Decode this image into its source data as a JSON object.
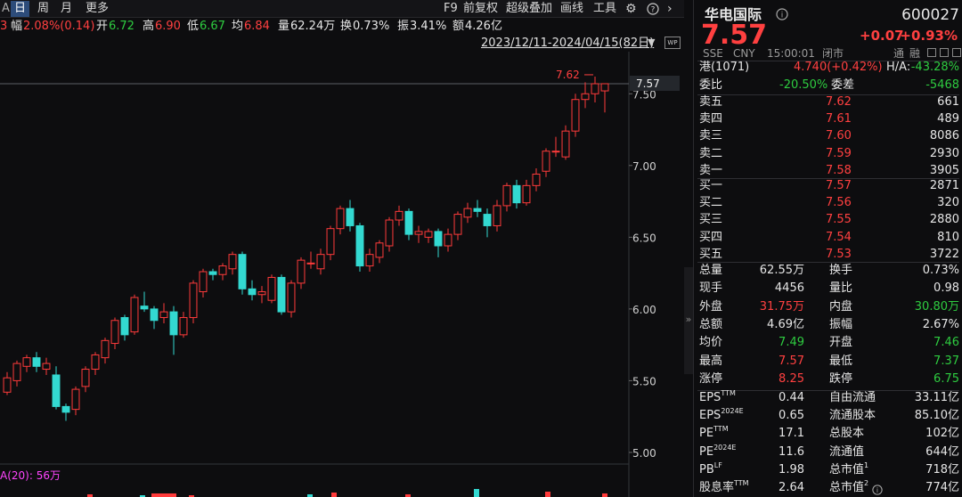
{
  "toolbar": {
    "left_glyph": "A",
    "periods": [
      "日",
      "周",
      "月",
      "更多"
    ],
    "active_period": "日",
    "tools": [
      "F9",
      "前复权",
      "超级叠加",
      "画线",
      "工具"
    ],
    "icons": [
      "gear-icon",
      "help-icon",
      "chevron-left-icon",
      "chevron-right-icon"
    ]
  },
  "info": {
    "lead": "3",
    "change_label": "幅",
    "change_value": "2.08%(0.14)",
    "open_label": "开",
    "open_value": "6.72",
    "high_label": "高",
    "high_value": "6.90",
    "low_label": "低",
    "low_value": "6.67",
    "avg_label": "均",
    "avg_value": "6.84",
    "vol_label": "量",
    "vol_value": "62.24万",
    "turnover_label": "换",
    "turnover_value": "0.73%",
    "amp_label": "振",
    "amp_value": "3.41%",
    "amount_label": "额",
    "amount_value": "4.26亿"
  },
  "range_label": "2023/12/11-2024/04/15(82日)",
  "range_arrow": "▼",
  "wp_label": "WP",
  "chart_data": {
    "type": "candlestick",
    "ylim": [
      4.95,
      7.57
    ],
    "y_ticks": [
      "7.50",
      "7.00",
      "6.50",
      "6.00",
      "5.50",
      "5.00"
    ],
    "y_tick_values": [
      7.5,
      7.0,
      6.5,
      6.0,
      5.5,
      5.0
    ],
    "last_price_label": "7.57",
    "high_annotation": "7.62",
    "volume_label": "A(20): 56万",
    "candles": [
      [
        5.42,
        5.52,
        5.4,
        5.56
      ],
      [
        5.5,
        5.62,
        5.46,
        5.64
      ],
      [
        5.6,
        5.66,
        5.56,
        5.68
      ],
      [
        5.66,
        5.6,
        5.56,
        5.7
      ],
      [
        5.58,
        5.62,
        5.54,
        5.66
      ],
      [
        5.54,
        5.32,
        5.3,
        5.6
      ],
      [
        5.32,
        5.28,
        5.22,
        5.34
      ],
      [
        5.3,
        5.44,
        5.26,
        5.46
      ],
      [
        5.46,
        5.58,
        5.42,
        5.6
      ],
      [
        5.58,
        5.68,
        5.54,
        5.7
      ],
      [
        5.66,
        5.78,
        5.62,
        5.8
      ],
      [
        5.76,
        5.92,
        5.72,
        5.94
      ],
      [
        5.94,
        5.82,
        5.78,
        5.96
      ],
      [
        5.84,
        6.08,
        5.82,
        6.1
      ],
      [
        6.02,
        6.0,
        5.98,
        6.12
      ],
      [
        6.0,
        5.92,
        5.86,
        6.02
      ],
      [
        5.94,
        5.98,
        5.9,
        6.04
      ],
      [
        5.98,
        5.82,
        5.68,
        6.02
      ],
      [
        5.82,
        5.94,
        5.8,
        5.98
      ],
      [
        5.94,
        6.18,
        5.9,
        6.2
      ],
      [
        6.12,
        6.26,
        6.08,
        6.28
      ],
      [
        6.26,
        6.24,
        6.2,
        6.28
      ],
      [
        6.24,
        6.3,
        6.2,
        6.32
      ],
      [
        6.28,
        6.38,
        6.24,
        6.4
      ],
      [
        6.38,
        6.14,
        6.1,
        6.4
      ],
      [
        6.14,
        6.1,
        6.06,
        6.2
      ],
      [
        6.1,
        6.12,
        6.04,
        6.16
      ],
      [
        6.06,
        6.22,
        6.04,
        6.24
      ],
      [
        6.22,
        5.98,
        5.96,
        6.24
      ],
      [
        5.98,
        6.18,
        5.94,
        6.2
      ],
      [
        6.18,
        6.34,
        6.14,
        6.36
      ],
      [
        6.32,
        6.32,
        6.28,
        6.4
      ],
      [
        6.28,
        6.38,
        6.24,
        6.42
      ],
      [
        6.38,
        6.56,
        6.34,
        6.58
      ],
      [
        6.56,
        6.7,
        6.52,
        6.72
      ],
      [
        6.7,
        6.58,
        6.54,
        6.76
      ],
      [
        6.58,
        6.3,
        6.26,
        6.6
      ],
      [
        6.3,
        6.38,
        6.26,
        6.42
      ],
      [
        6.36,
        6.46,
        6.32,
        6.48
      ],
      [
        6.44,
        6.62,
        6.4,
        6.64
      ],
      [
        6.62,
        6.68,
        6.58,
        6.72
      ],
      [
        6.68,
        6.52,
        6.48,
        6.7
      ],
      [
        6.52,
        6.54,
        6.46,
        6.58
      ],
      [
        6.5,
        6.54,
        6.46,
        6.56
      ],
      [
        6.54,
        6.44,
        6.36,
        6.56
      ],
      [
        6.44,
        6.52,
        6.4,
        6.56
      ],
      [
        6.52,
        6.66,
        6.48,
        6.68
      ],
      [
        6.64,
        6.7,
        6.6,
        6.74
      ],
      [
        6.7,
        6.68,
        6.64,
        6.76
      ],
      [
        6.66,
        6.58,
        6.5,
        6.7
      ],
      [
        6.58,
        6.72,
        6.54,
        6.76
      ],
      [
        6.72,
        6.86,
        6.68,
        6.88
      ],
      [
        6.86,
        6.74,
        6.7,
        6.9
      ],
      [
        6.74,
        6.86,
        6.72,
        6.9
      ],
      [
        6.86,
        6.94,
        6.82,
        6.98
      ],
      [
        6.96,
        7.1,
        6.92,
        7.12
      ],
      [
        7.1,
        7.1,
        7.06,
        7.2
      ],
      [
        7.06,
        7.24,
        7.04,
        7.28
      ],
      [
        7.24,
        7.46,
        7.2,
        7.5
      ],
      [
        7.46,
        7.5,
        7.4,
        7.58
      ],
      [
        7.5,
        7.57,
        7.44,
        7.62
      ],
      [
        7.52,
        7.57,
        7.37,
        7.57
      ]
    ],
    "volumes": [
      0.3,
      0.2,
      0.4,
      0.2,
      0.3,
      0.5,
      0.3,
      0.9,
      0.6,
      0.4
    ]
  },
  "stock": {
    "name": "华电国际",
    "info_icon": "info-icon",
    "code": "600027",
    "price": "7.57",
    "change": "+0.07",
    "change_pct": "+0.93%",
    "exchange": "SSE",
    "currency": "CNY",
    "time": "15:00:01",
    "status": "闭市",
    "tags": [
      "通",
      "融"
    ],
    "hk_label": "港(1071)",
    "hk_value": "4.740(+0.42%)",
    "ha_label": "H/A:",
    "ha_value": "-43.28%"
  },
  "order_stats": {
    "wb_label": "委比",
    "wb_value": "-20.50%",
    "wc_label": "委差",
    "wc_value": "-5468"
  },
  "asks": [
    {
      "label": "卖五",
      "price": "7.62",
      "volume": "661"
    },
    {
      "label": "卖四",
      "price": "7.61",
      "volume": "489"
    },
    {
      "label": "卖三",
      "price": "7.60",
      "volume": "8086"
    },
    {
      "label": "卖二",
      "price": "7.59",
      "volume": "2930"
    },
    {
      "label": "卖一",
      "price": "7.58",
      "volume": "3905"
    }
  ],
  "bids": [
    {
      "label": "买一",
      "price": "7.57",
      "volume": "2871"
    },
    {
      "label": "买二",
      "price": "7.56",
      "volume": "320"
    },
    {
      "label": "买三",
      "price": "7.55",
      "volume": "2880"
    },
    {
      "label": "买四",
      "price": "7.54",
      "volume": "810"
    },
    {
      "label": "买五",
      "price": "7.53",
      "volume": "3722"
    }
  ],
  "stats": [
    {
      "l1": "总量",
      "v1": "62.55万",
      "c1": "white",
      "l2": "换手",
      "v2": "0.73%",
      "c2": "white"
    },
    {
      "l1": "现手",
      "v1": "4456",
      "c1": "white",
      "l2": "量比",
      "v2": "0.98",
      "c2": "white"
    },
    {
      "l1": "外盘",
      "v1": "31.75万",
      "c1": "up",
      "l2": "内盘",
      "v2": "30.80万",
      "c2": "down"
    },
    {
      "l1": "总额",
      "v1": "4.69亿",
      "c1": "white",
      "l2": "振幅",
      "v2": "2.67%",
      "c2": "white"
    },
    {
      "l1": "均价",
      "v1": "7.49",
      "c1": "down",
      "l2": "开盘",
      "v2": "7.46",
      "c2": "down"
    },
    {
      "l1": "最高",
      "v1": "7.57",
      "c1": "up",
      "l2": "最低",
      "v2": "7.37",
      "c2": "down"
    },
    {
      "l1": "涨停",
      "v1": "8.25",
      "c1": "up",
      "l2": "跌停",
      "v2": "6.75",
      "c2": "down"
    }
  ],
  "fundamentals": [
    {
      "l1": "EPS",
      "s1": "TTM",
      "v1": "0.44",
      "l2": "自由流通",
      "s2": "",
      "v2": "33.11亿"
    },
    {
      "l1": "EPS",
      "s1": "2024E",
      "v1": "0.65",
      "l2": "流通股本",
      "s2": "",
      "v2": "85.10亿"
    },
    {
      "l1": "PE",
      "s1": "TTM",
      "v1": "17.1",
      "l2": "总股本",
      "s2": "",
      "v2": "102亿"
    },
    {
      "l1": "PE",
      "s1": "2024E",
      "v1": "11.6",
      "l2": "流通值",
      "s2": "",
      "v2": "644亿"
    },
    {
      "l1": "PB",
      "s1": "LF",
      "v1": "1.98",
      "l2": "总市值",
      "s2": "1",
      "v2": "718亿"
    },
    {
      "l1": "股息率",
      "s1": "TTM",
      "v1": "2.64",
      "l2": "总市值",
      "s2": "2",
      "v2": "774亿"
    }
  ],
  "divider_glyph": "»",
  "colors": {
    "up": "#ff4040",
    "down": "#2ecc40",
    "cyan": "#33d9d1",
    "bg": "#0d0d0f"
  }
}
